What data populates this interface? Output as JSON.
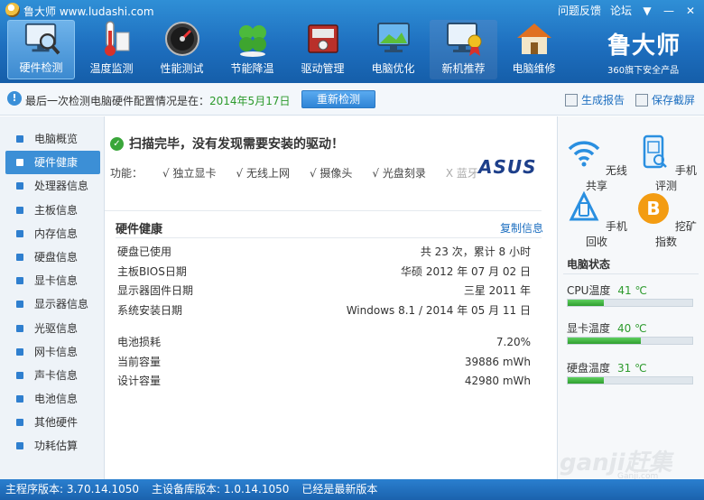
{
  "titlebar": {
    "title": "鲁大师 www.ludashi.com",
    "feedback": "问题反馈",
    "forum": "论坛",
    "menu_glyph": "▼",
    "minimize_glyph": "—",
    "close_glyph": "✕"
  },
  "toolbar": {
    "items": [
      {
        "label": "硬件检测",
        "icon": "monitor-magnifier-icon",
        "active": true
      },
      {
        "label": "温度监测",
        "icon": "thermometer-icon"
      },
      {
        "label": "性能测试",
        "icon": "speedometer-icon"
      },
      {
        "label": "节能降温",
        "icon": "clover-icon"
      },
      {
        "label": "驱动管理",
        "icon": "driver-box-icon"
      },
      {
        "label": "电脑优化",
        "icon": "landscape-monitor-icon"
      },
      {
        "label": "新机推荐",
        "icon": "monitor-medal-icon"
      },
      {
        "label": "电脑维修",
        "icon": "house-icon"
      }
    ],
    "brand_name": "鲁大师",
    "brand_sub": "360旗下安全产品"
  },
  "infobar": {
    "text": "最后一次检测电脑硬件配置情况是在：",
    "date": "2014年5月17日",
    "recheck_label": "重新检测",
    "report_label": "生成报告",
    "screenshot_label": "保存截屏"
  },
  "sidebar": {
    "items": [
      {
        "label": "电脑概览"
      },
      {
        "label": "硬件健康",
        "active": true
      },
      {
        "label": "处理器信息"
      },
      {
        "label": "主板信息"
      },
      {
        "label": "内存信息"
      },
      {
        "label": "硬盘信息"
      },
      {
        "label": "显卡信息"
      },
      {
        "label": "显示器信息"
      },
      {
        "label": "光驱信息"
      },
      {
        "label": "网卡信息"
      },
      {
        "label": "声卡信息"
      },
      {
        "label": "电池信息"
      },
      {
        "label": "其他硬件"
      },
      {
        "label": "功耗估算"
      }
    ]
  },
  "main": {
    "scan_message": "扫描完毕，没有发现需要安装的驱动！",
    "features_label": "功能：",
    "features": [
      {
        "text": "√ 独立显卡",
        "enabled": true
      },
      {
        "text": "√ 无线上网",
        "enabled": true
      },
      {
        "text": "√ 摄像头",
        "enabled": true
      },
      {
        "text": "√ 光盘刻录",
        "enabled": true
      },
      {
        "text": "X 蓝牙",
        "enabled": false
      }
    ],
    "brand_logo": "ASUS",
    "section_title": "硬件健康",
    "copy_label": "复制信息",
    "rows": [
      {
        "label": "硬盘已使用",
        "value": "共 23 次，累计 8 小时"
      },
      {
        "label": "主板BIOS日期",
        "value": "华硕 2012 年 07 月 02 日"
      },
      {
        "label": "显示器固件日期",
        "value": "三星 2011 年"
      },
      {
        "label": "系统安装日期",
        "value": "Windows 8.1 / 2014 年 05 月 11 日"
      }
    ],
    "battery_rows": [
      {
        "label": "电池损耗",
        "value": "7.20%"
      },
      {
        "label": "当前容量",
        "value": "39886 mWh"
      },
      {
        "label": "设计容量",
        "value": "42980 mWh"
      }
    ]
  },
  "right": {
    "quick": [
      {
        "label": "无线共享",
        "icon": "wifi-icon"
      },
      {
        "label": "手机评测",
        "icon": "phone-scan-icon"
      },
      {
        "label": "手机回收",
        "icon": "recycle-icon"
      },
      {
        "label": "挖矿指数",
        "icon": "bitcoin-icon"
      }
    ],
    "status_title": "电脑状态",
    "temps": [
      {
        "label": "CPU温度",
        "value": "41 ℃",
        "level": 0.29
      },
      {
        "label": "显卡温度",
        "value": "40 ℃",
        "level": 0.59
      },
      {
        "label": "硬盘温度",
        "value": "31 ℃",
        "level": 0.29
      }
    ],
    "accent_color": "#2e9e2e"
  },
  "watermark": {
    "text": "ganji赶集",
    "sub": "Ganji.com"
  },
  "statusbar": {
    "program_version": "主程序版本: 3.70.14.1050",
    "db_version": "主设备库版本: 1.0.14.1050",
    "latest": "已经是最新版本"
  }
}
